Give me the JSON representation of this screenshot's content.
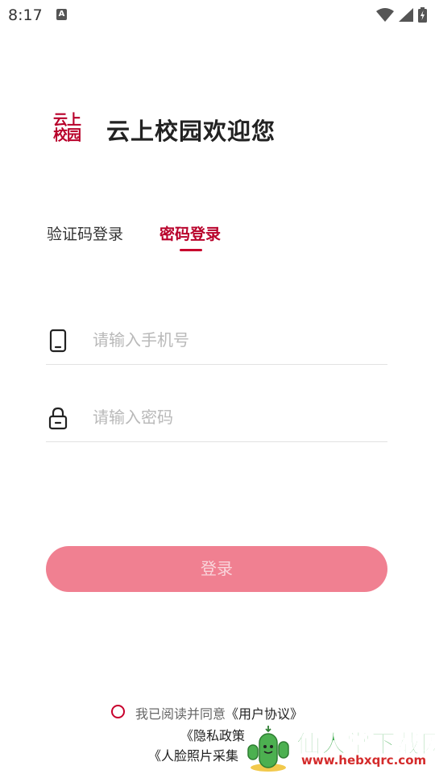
{
  "status_bar": {
    "time": "8:17",
    "notification_icon": "A"
  },
  "header": {
    "logo_line1": "云上",
    "logo_line2": "校园",
    "title": "云上校园欢迎您"
  },
  "tabs": [
    {
      "label": "验证码登录",
      "active": false
    },
    {
      "label": "密码登录",
      "active": true
    }
  ],
  "form": {
    "phone_placeholder": "请输入手机号",
    "password_placeholder": "请输入密码",
    "phone_value": "",
    "password_value": "",
    "login_label": "登录"
  },
  "agreement": {
    "prefix": "我已阅读并同意",
    "user_agreement": "《用户协议》",
    "privacy_policy": "《隐私政策",
    "face_photo": "《人脸照片采集"
  },
  "watermark": {
    "title": "仙人掌下载网",
    "url": "www.hebxqrc.com"
  },
  "colors": {
    "accent": "#c8002d",
    "button": "#f08091",
    "divider": "#e2e2e2"
  }
}
